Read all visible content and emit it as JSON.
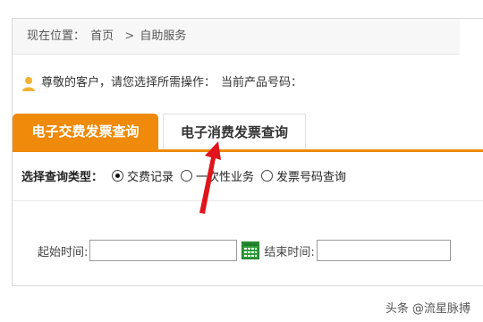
{
  "breadcrumb": {
    "prefix": "现在位置：",
    "home": "首页",
    "separator": ">",
    "current": "自助服务"
  },
  "welcome": {
    "text": "尊敬的客户，请您选择所需操作：",
    "product_label": "当前产品号码："
  },
  "tabs": [
    {
      "label": "电子交费发票查询",
      "active": true
    },
    {
      "label": "电子消费发票查询",
      "active": false
    }
  ],
  "query": {
    "label": "选择查询类型：",
    "options": [
      {
        "label": "交费记录",
        "checked": true
      },
      {
        "label": "一次性业务",
        "checked": false
      },
      {
        "label": "发票号码查询",
        "checked": false
      }
    ]
  },
  "dates": {
    "start_label": "起始时间:",
    "start_value": "",
    "end_label": "结束时间:",
    "end_value": ""
  },
  "watermark": "头条 @流星脉搏",
  "colors": {
    "accent": "#ef8a0b",
    "arrow": "#e0151c",
    "calendar": "#2e9b3b"
  }
}
